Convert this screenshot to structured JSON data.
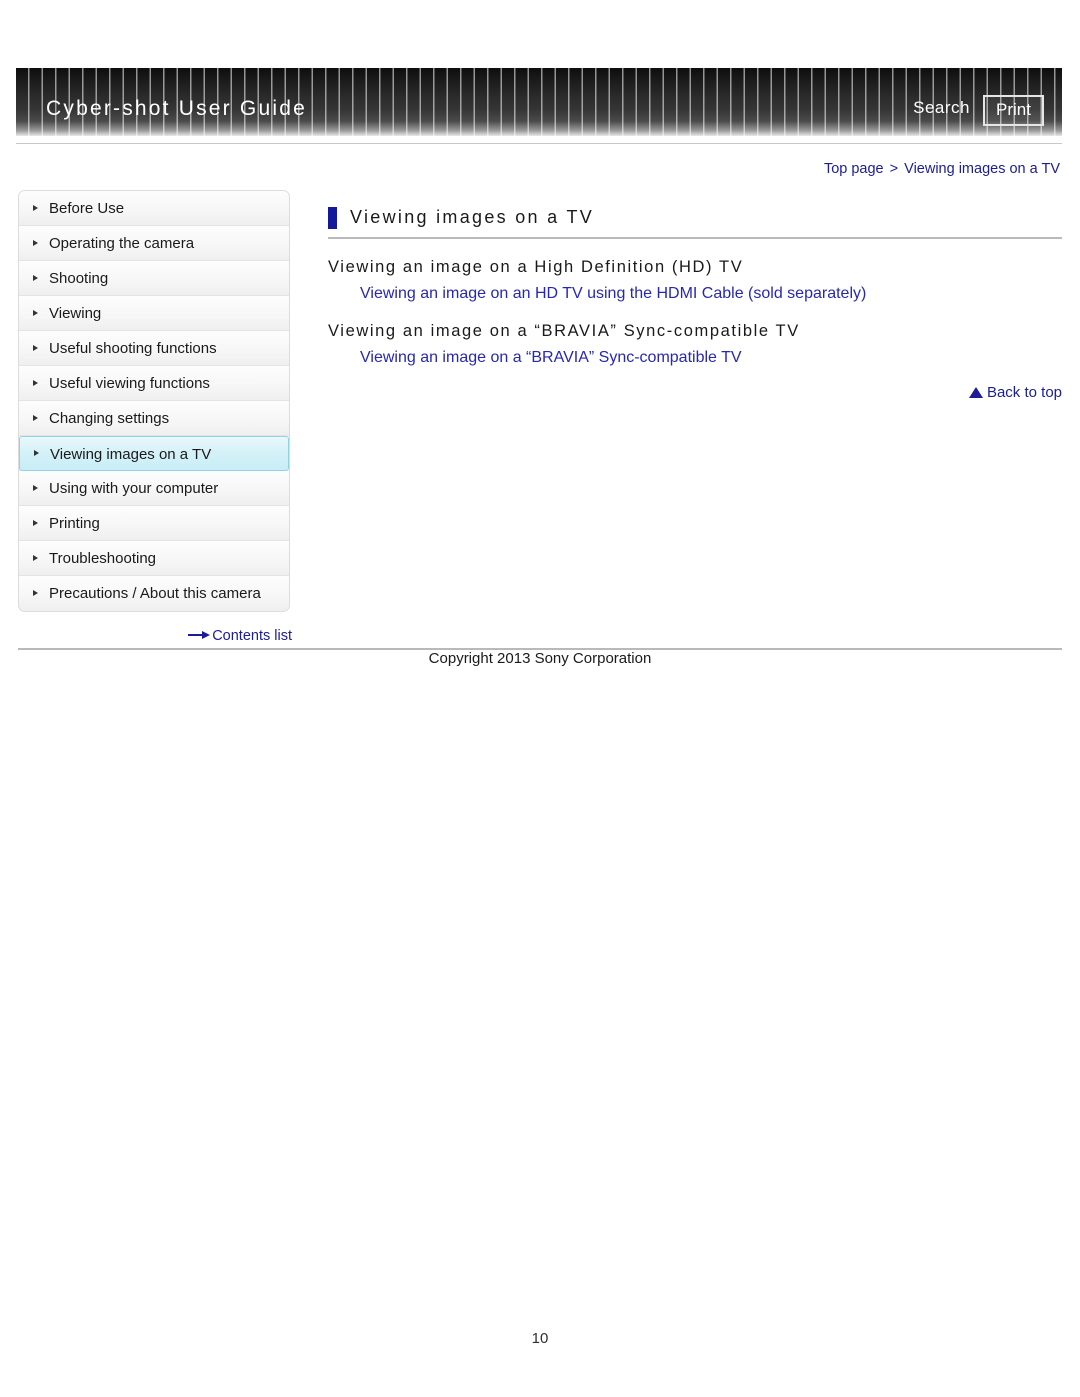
{
  "header": {
    "title": "Cyber-shot User Guide",
    "search_label": "Search",
    "print_label": "Print"
  },
  "breadcrumb": {
    "top_page": "Top page",
    "separator": ">",
    "current": "Viewing images on a TV"
  },
  "sidebar": {
    "items": [
      {
        "label": "Before Use",
        "active": false
      },
      {
        "label": "Operating the camera",
        "active": false
      },
      {
        "label": "Shooting",
        "active": false
      },
      {
        "label": "Viewing",
        "active": false
      },
      {
        "label": "Useful shooting functions",
        "active": false
      },
      {
        "label": "Useful viewing functions",
        "active": false
      },
      {
        "label": "Changing settings",
        "active": false
      },
      {
        "label": "Viewing images on a TV",
        "active": true
      },
      {
        "label": "Using with your computer",
        "active": false
      },
      {
        "label": "Printing",
        "active": false
      },
      {
        "label": "Troubleshooting",
        "active": false
      },
      {
        "label": "Precautions / About this camera",
        "active": false
      }
    ],
    "contents_list_label": "Contents list"
  },
  "main": {
    "page_title": "Viewing images on a TV",
    "sections": [
      {
        "heading": "Viewing an image on a High Definition (HD) TV",
        "links": [
          "Viewing an image on an HD TV using the HDMI Cable (sold separately)"
        ]
      },
      {
        "heading": "Viewing an image on a “BRAVIA” Sync-compatible TV",
        "links": [
          "Viewing an image on a “BRAVIA” Sync-compatible TV"
        ]
      }
    ],
    "back_to_top_label": "Back to top"
  },
  "footer": {
    "copyright": "Copyright 2013 Sony Corporation",
    "page_number": "10"
  },
  "colors": {
    "accent_navy": "#14189b",
    "link_blue": "#2727b5",
    "breadcrumb_blue": "#1c1c96",
    "active_item_bg": "#d4f1f8",
    "active_item_border": "#8fd3e4"
  }
}
